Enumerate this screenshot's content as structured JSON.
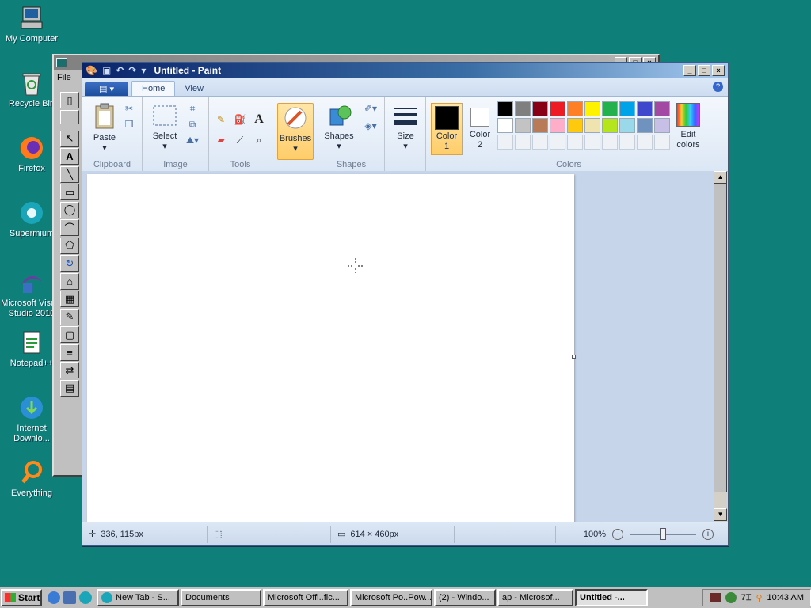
{
  "desktop": {
    "icons": [
      {
        "label": "My Computer"
      },
      {
        "label": "Recycle Bin"
      },
      {
        "label": "Firefox"
      },
      {
        "label": "Supermium"
      },
      {
        "label": "Microsoft Visual Studio 2010"
      },
      {
        "label": "Notepad++"
      },
      {
        "label": "Internet Downlo..."
      },
      {
        "label": "Everything"
      }
    ]
  },
  "back_window": {
    "menu_file": "File"
  },
  "paint": {
    "title": "Untitled - Paint",
    "tabs": {
      "home": "Home",
      "view": "View"
    },
    "groups": {
      "clipboard": "Clipboard",
      "image": "Image",
      "tools": "Tools",
      "shapes": "Shapes",
      "colors": "Colors"
    },
    "buttons": {
      "paste": "Paste",
      "select": "Select",
      "brushes": "Brushes",
      "shapes": "Shapes",
      "size": "Size",
      "color1_a": "Color",
      "color1_b": "1",
      "color2_a": "Color",
      "color2_b": "2",
      "edit_colors_a": "Edit",
      "edit_colors_b": "colors"
    },
    "colors": {
      "color1": "#000000",
      "color2": "#ffffff",
      "palette_row1": [
        "#000000",
        "#7f7f7f",
        "#880015",
        "#ed1c24",
        "#ff7f27",
        "#fff200",
        "#22b14c",
        "#00a2e8",
        "#3f48cc",
        "#a349a4"
      ],
      "palette_row2": [
        "#ffffff",
        "#c3c3c3",
        "#b97a57",
        "#ffaec9",
        "#ffc90e",
        "#efe4b0",
        "#b5e61d",
        "#99d9ea",
        "#7092be",
        "#c8bfe7"
      ]
    },
    "status": {
      "cursor_pos": "336, 115px",
      "canvas_size": "614 × 460px",
      "zoom": "100%"
    }
  },
  "taskbar": {
    "start": "Start",
    "items": [
      {
        "label": "New Tab - S..."
      },
      {
        "label": "Documents"
      },
      {
        "label": "Microsoft Offi..fic..."
      },
      {
        "label": "Microsoft Po..Pow..."
      },
      {
        "label": "(2) - Windo..."
      },
      {
        "label": "ap - Microsof..."
      },
      {
        "label": "Untitled -..."
      }
    ],
    "clock": "10:43 AM"
  }
}
